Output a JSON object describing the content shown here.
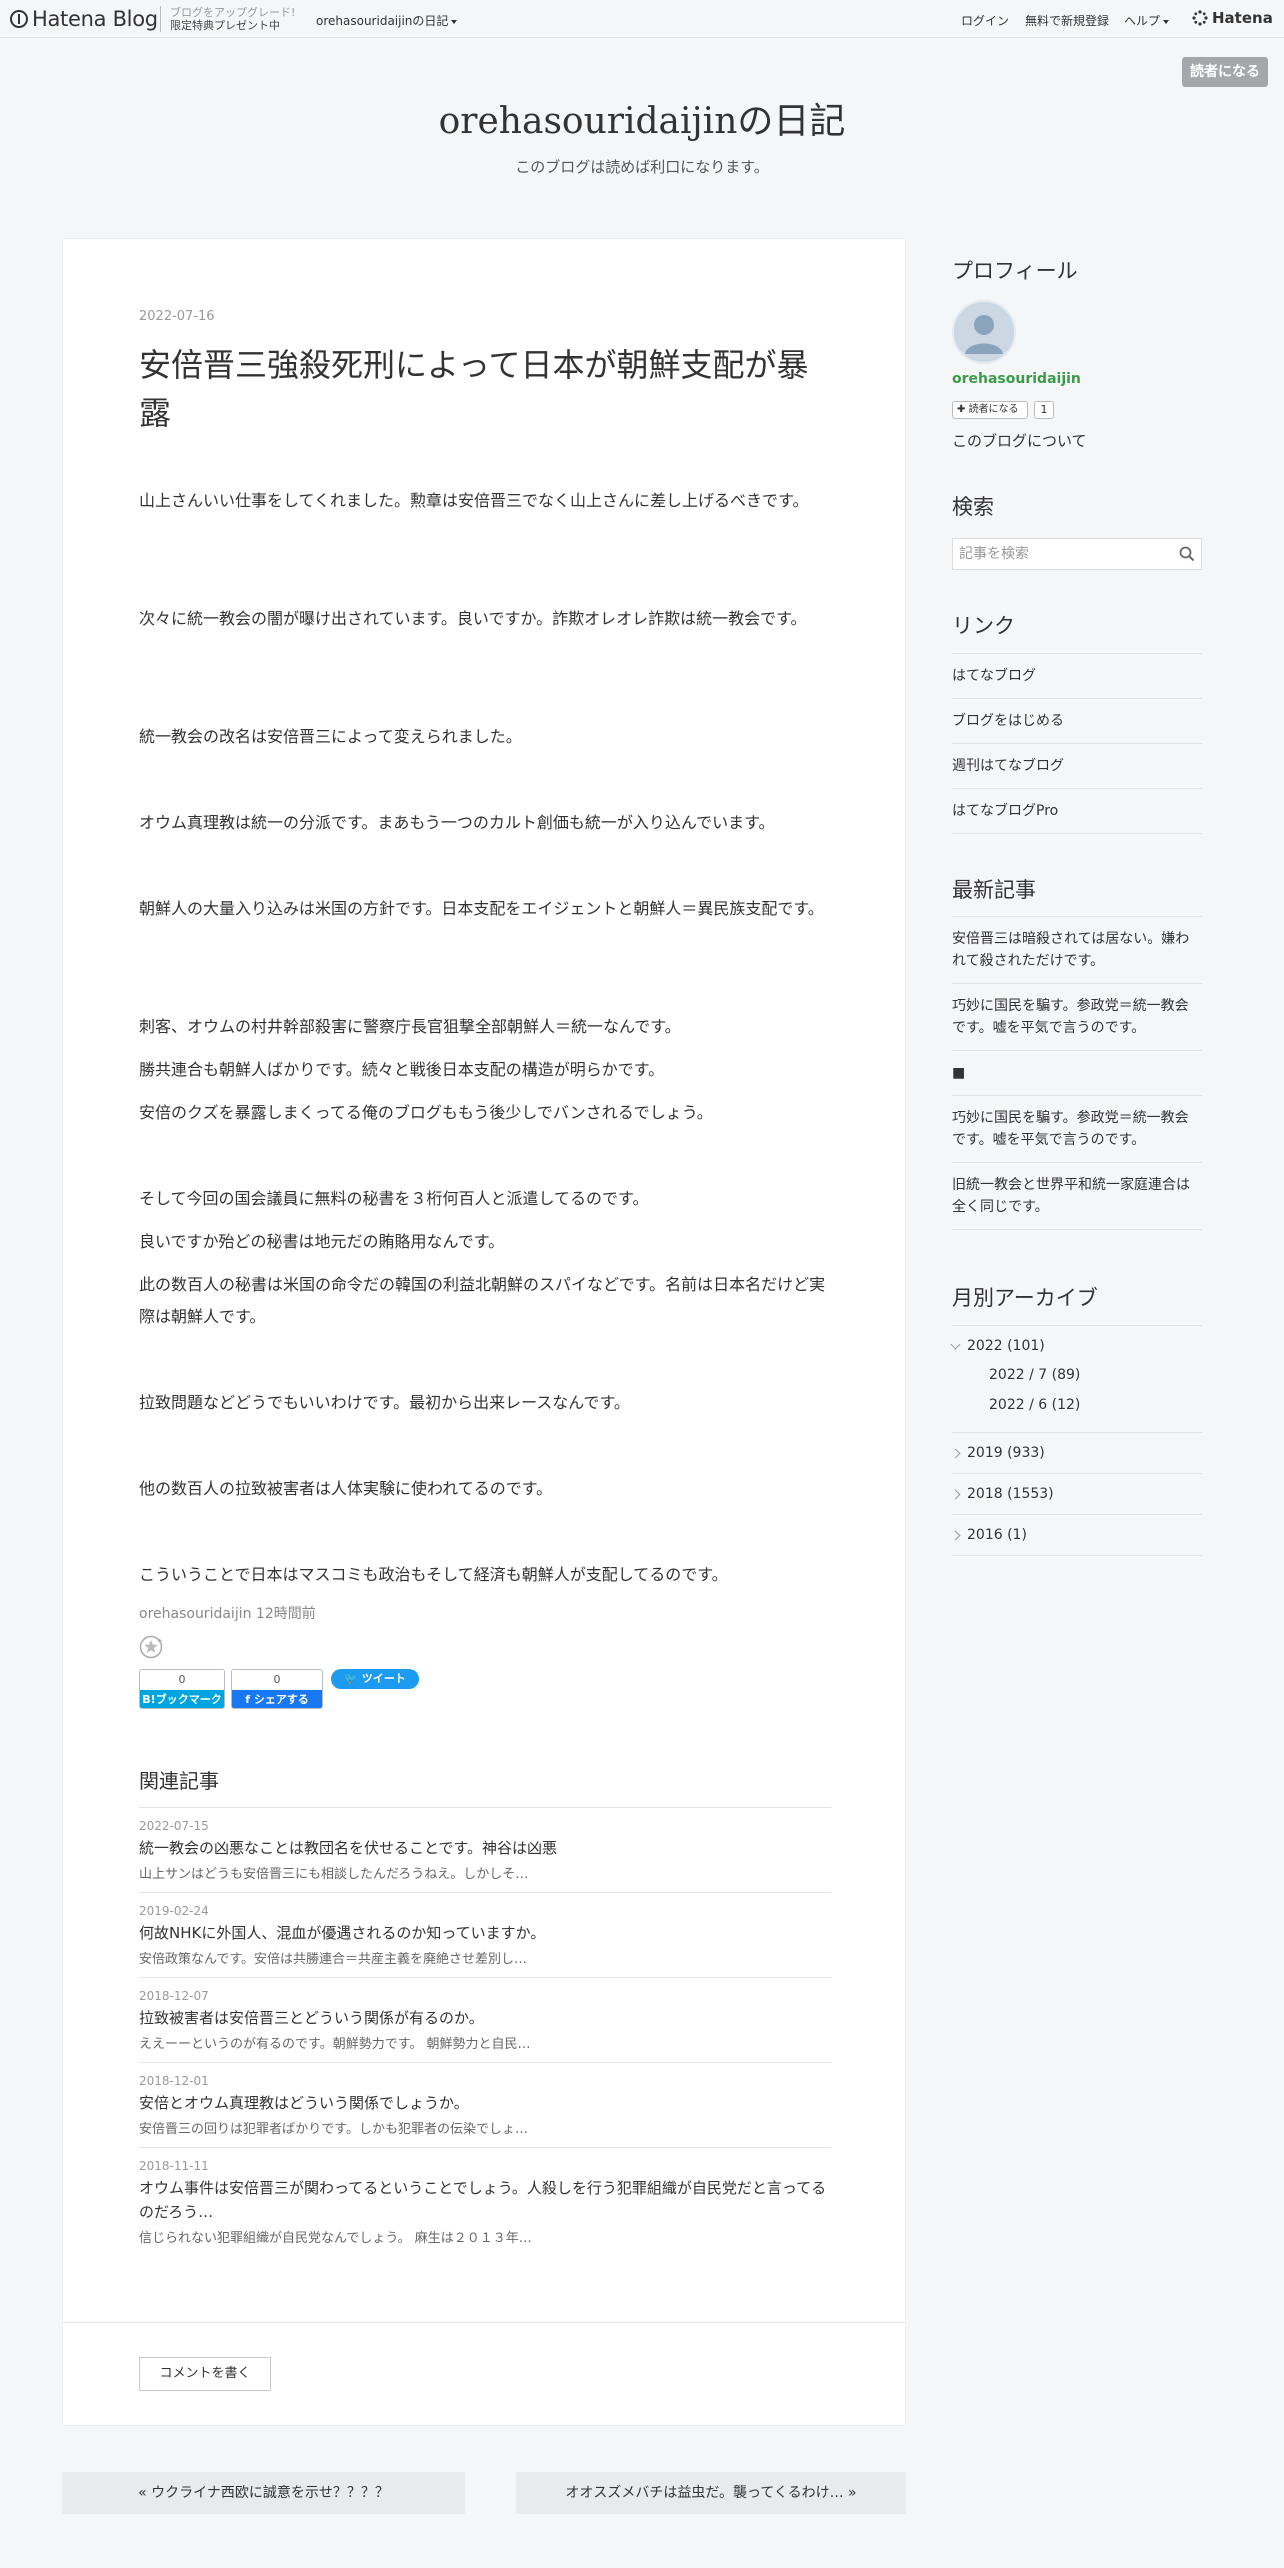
{
  "topbar": {
    "logo": "Hatena Blog",
    "promo_line1": "ブログをアップグレード!",
    "promo_line2": "限定特典プレゼント中",
    "blog_menu": "orehasouridaijinの日記",
    "login": "ログイン",
    "signup": "無料で新規登録",
    "help": "ヘルプ",
    "brand": "Hatena"
  },
  "subscribe_label": "読者になる",
  "blog": {
    "title": "orehasouridaijinの日記",
    "description": "このブログは読めば利口になります。"
  },
  "article": {
    "date": "2022-07-16",
    "title": "安倍晋三強殺死刑によって日本が朝鮮支配が暴露",
    "paragraphs": [
      "山上さんいい仕事をしてくれました。勲章は安倍晋三でなく山上さんに差し上げるべきです。",
      "次々に統一教会の闇が曝け出されています。良いですか。詐欺オレオレ詐欺は統一教会です。",
      "統一教会の改名は安倍晋三によって変えられました。",
      "オウム真理教は統一の分派です。まあもう一つのカルト創価も統一が入り込んでいます。",
      "朝鮮人の大量入り込みは米国の方針です。日本支配をエイジェントと朝鮮人＝異民族支配です。",
      "刺客、オウムの村井幹部殺害に警察庁長官狙撃全部朝鮮人＝統一なんです。",
      "勝共連合も朝鮮人ばかりです。続々と戦後日本支配の構造が明らかです。",
      "安倍のクズを暴露しまくってる俺のブログももう後少しでバンされるでしょう。",
      "そして今回の国会議員に無料の秘書を３桁何百人と派遣してるのです。",
      "良いですか殆どの秘書は地元だの賄賂用なんです。",
      "此の数百人の秘書は米国の命令だの韓国の利益北朝鮮のスパイなどです。名前は日本名だけど実際は朝鮮人です。",
      "拉致問題などどうでもいいわけです。最初から出来レースなんです。",
      "他の数百人の拉致被害者は人体実験に使われてるのです。",
      "こういうことで日本はマスコミも政治もそして経済も朝鮮人が支配してるのです。"
    ],
    "author": "orehasouridaijin",
    "time_ago": "12時間前",
    "bookmark_count": "0",
    "bookmark_label": "B!ブックマーク",
    "share_count": "0",
    "share_label": "シェアする",
    "tweet_label": "ツイート"
  },
  "related": {
    "heading": "関連記事",
    "items": [
      {
        "date": "2022-07-15",
        "title": "統一教会の凶悪なことは教団名を伏せることです。神谷は凶悪",
        "excerpt": "山上サンはどうも安倍晋三にも相談したんだろうねえ。しかしそ…"
      },
      {
        "date": "2019-02-24",
        "title": "何故NHKに外国人、混血が優遇されるのか知っていますか。",
        "excerpt": "安倍政策なんです。安倍は共勝連合＝共産主義を廃絶させ差別し…"
      },
      {
        "date": "2018-12-07",
        "title": "拉致被害者は安倍晋三とどういう関係が有るのか。",
        "excerpt": "ええーーというのが有るのです。朝鮮勢力です。 朝鮮勢力と自民…"
      },
      {
        "date": "2018-12-01",
        "title": "安倍とオウム真理教はどういう関係でしょうか。",
        "excerpt": "安倍晋三の回りは犯罪者ばかりです。しかも犯罪者の伝染でしょ…"
      },
      {
        "date": "2018-11-11",
        "title": "オウム事件は安倍晋三が関わってるということでしょう。人殺しを行う犯罪組織が自民党だと言ってるのだろう…",
        "excerpt": "信じられない犯罪組織が自民党なんでしょう。 麻生は２０１３年…"
      }
    ]
  },
  "comment_button": "コメントを書く",
  "pager": {
    "prev": "« ウクライナ西欧に誠意を示せ？？？？",
    "next": "オオスズメバチは益虫だ。襲ってくるわけ… »"
  },
  "sidebar": {
    "profile_heading": "プロフィール",
    "username": "orehasouridaijin",
    "subscribe_small": "読者になる",
    "subscriber_count": "1",
    "about": "このブログについて",
    "search_heading": "検索",
    "search_placeholder": "記事を検索",
    "links_heading": "リンク",
    "links": [
      "はてなブログ",
      "ブログをはじめる",
      "週刊はてなブログ",
      "はてなブログPro"
    ],
    "recent_heading": "最新記事",
    "recent": [
      "安倍晋三は暗殺されては居ない。嫌われて殺されただけです。",
      "巧妙に国民を騙す。参政党＝統一教会です。嘘を平気で言うのです。",
      "■",
      "巧妙に国民を騙す。参政党＝統一教会です。嘘を平気で言うのです。",
      "旧統一教会と世界平和統一家庭連合は全く同じです。"
    ],
    "archive_heading": "月別アーカイブ",
    "archive": [
      {
        "label": "2022 (101)",
        "expanded": true,
        "months": [
          "2022 / 7 (89)",
          "2022 / 6 (12)"
        ]
      },
      {
        "label": "2019 (933)",
        "expanded": false
      },
      {
        "label": "2018 (1553)",
        "expanded": false
      },
      {
        "label": "2016 (1)",
        "expanded": false
      }
    ]
  },
  "colors": {
    "accent_green": "#3c9a4b",
    "bookmark_blue": "#00a4de",
    "facebook_blue": "#1877f2",
    "twitter_blue": "#1d9bf0"
  }
}
